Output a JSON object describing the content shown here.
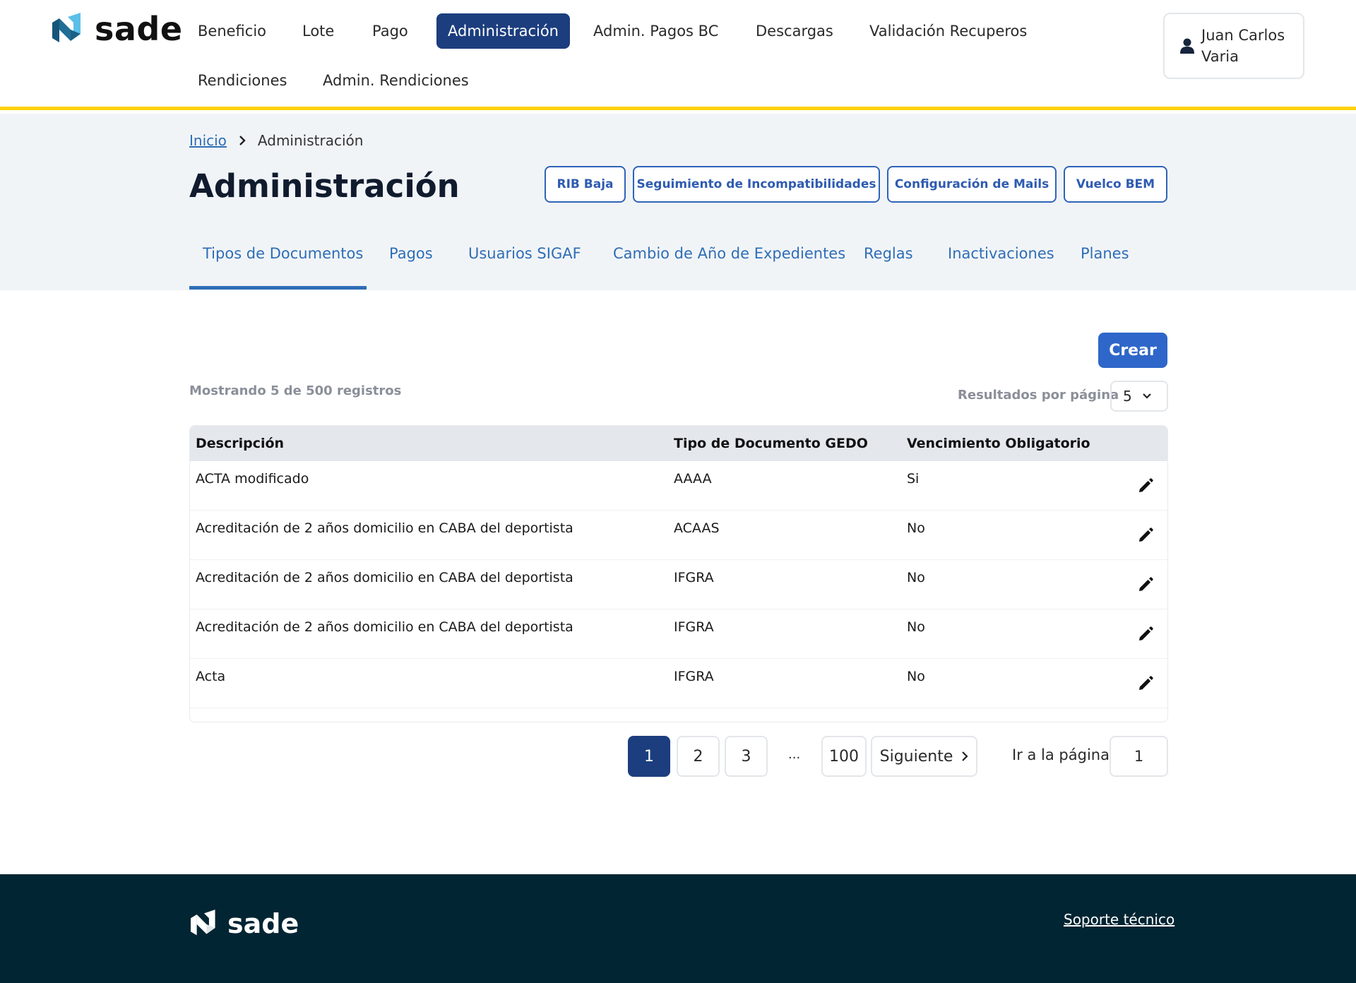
{
  "header": {
    "logo_text": "sade",
    "nav": [
      {
        "label": "Beneficio",
        "active": false
      },
      {
        "label": "Lote",
        "active": false
      },
      {
        "label": "Pago",
        "active": false
      },
      {
        "label": "Administración",
        "active": true
      },
      {
        "label": "Admin. Pagos BC",
        "active": false
      },
      {
        "label": "Descargas",
        "active": false
      },
      {
        "label": "Validación Recuperos",
        "active": false
      },
      {
        "label": "Rendiciones",
        "active": false
      },
      {
        "label": "Admin. Rendiciones",
        "active": false
      }
    ],
    "user": {
      "name": "Juan Carlos Varia",
      "icon": "user-icon"
    }
  },
  "breadcrumb": {
    "home": "Inicio",
    "current": "Administración"
  },
  "page": {
    "title": "Administración",
    "actions": [
      "RIB Baja",
      "Seguimiento de Incompatibilidades",
      "Configuración de Mails",
      "Vuelco BEM"
    ],
    "tabs": [
      "Tipos de Documentos",
      "Pagos",
      "Usuarios SIGAF",
      "Cambio de Año de Expedientes",
      "Reglas",
      "Inactivaciones",
      "Planes"
    ],
    "active_tab": "Tipos de Documentos"
  },
  "main": {
    "create_label": "Crear",
    "showing_text": "Mostrando 5 de 500 registros",
    "per_page_label": "Resultados por página",
    "per_page_value": "5",
    "table": {
      "headers": [
        "Descripción",
        "Tipo de Documento GEDO",
        "Vencimiento Obligatorio"
      ],
      "rows": [
        [
          "ACTA modificado",
          "AAAA",
          "Si"
        ],
        [
          "Acreditación de 2 años domicilio en CABA del deportista",
          "ACAAS",
          "No"
        ],
        [
          "Acreditación de 2 años domicilio en CABA del deportista",
          "IFGRA",
          "No"
        ],
        [
          "Acreditación de 2 años domicilio en CABA del deportista",
          "IFGRA",
          "No"
        ],
        [
          "Acta",
          "IFGRA",
          "No"
        ]
      ]
    },
    "pagination": {
      "pages": [
        "1",
        "2",
        "3"
      ],
      "ellipsis": "...",
      "last": "100",
      "next_label": "Siguiente",
      "current_page": "1",
      "goto_label": "Ir a la página",
      "goto_value": "1"
    }
  },
  "footer": {
    "logo_text": "sade",
    "support_link": "Soporte técnico"
  },
  "colors": {
    "accent": "#2e67c9",
    "nav_active": "#1c3e7e",
    "header_border": "#fdd306",
    "footer_bg": "#022533",
    "banner_bg": "#f1f4f7",
    "link": "#2e6eb6"
  }
}
